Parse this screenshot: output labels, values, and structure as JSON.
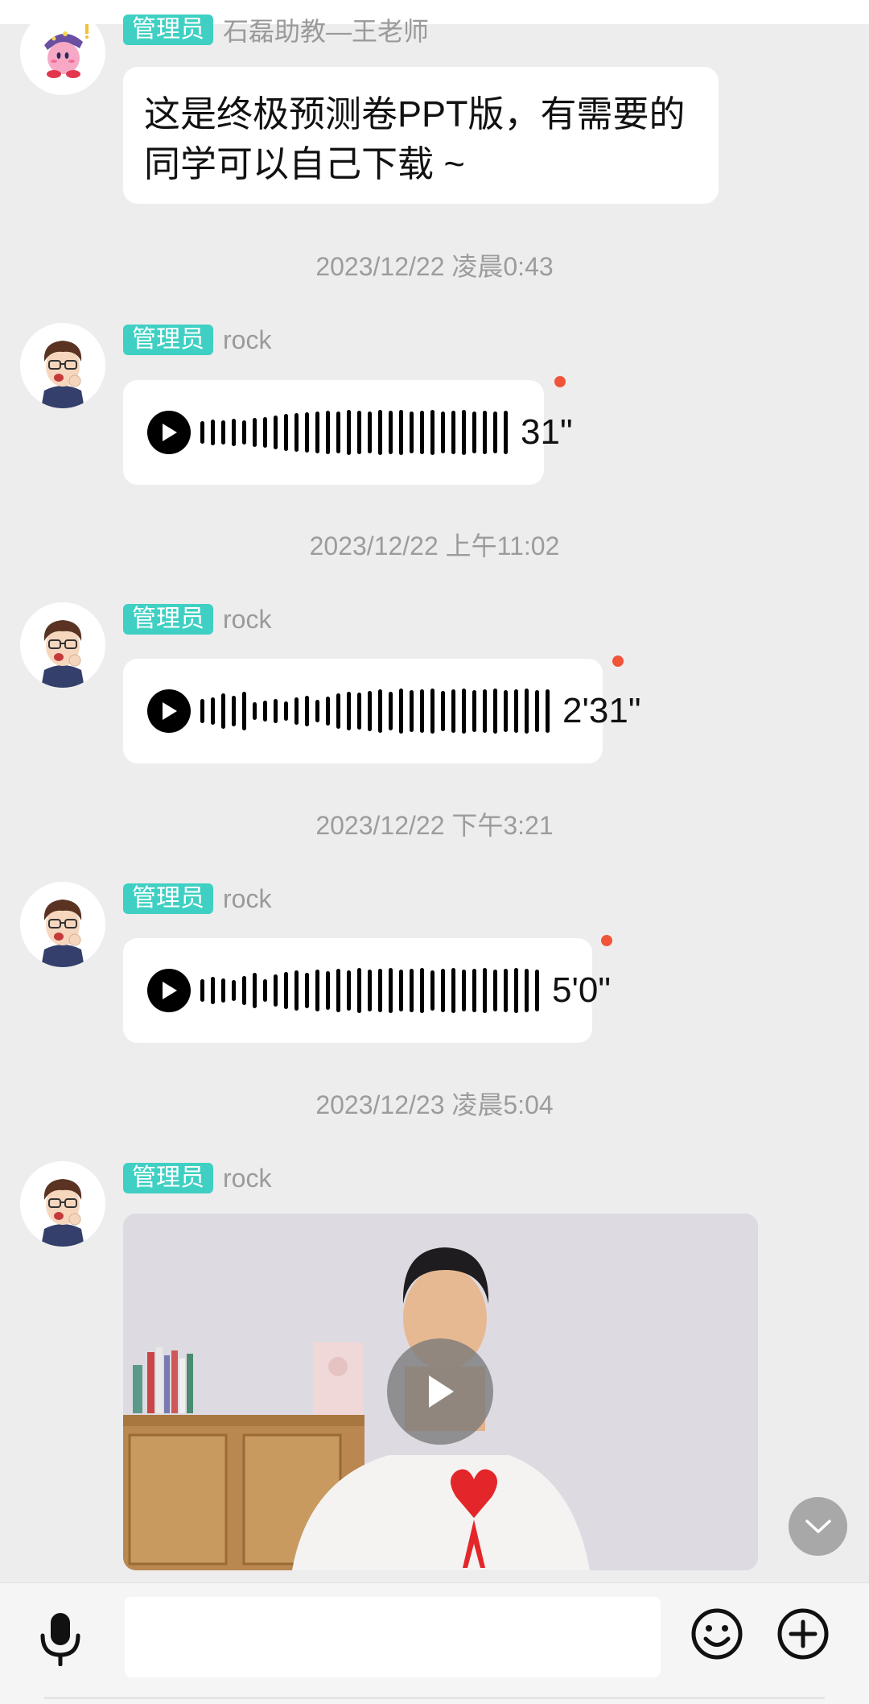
{
  "messages": [
    {
      "badge": "管理员",
      "sender": "石磊助教—王老师",
      "text": "这是终极预测卷PPT版，有需要的同学可以自己下载 ~",
      "avatar_icon": "kirby-avatar-icon"
    },
    {
      "timestamp": "2023/12/22 凌晨0:43",
      "badge": "管理员",
      "sender": "rock",
      "voice_duration": "31\"",
      "unread": true,
      "avatar_icon": "cartoon-man-avatar-icon"
    },
    {
      "timestamp": "2023/12/22 上午11:02",
      "badge": "管理员",
      "sender": "rock",
      "voice_duration": "2'31\"",
      "unread": true,
      "avatar_icon": "cartoon-man-avatar-icon"
    },
    {
      "timestamp": "2023/12/22 下午3:21",
      "badge": "管理员",
      "sender": "rock",
      "voice_duration": "5'0\"",
      "unread": true,
      "avatar_icon": "cartoon-man-avatar-icon"
    },
    {
      "timestamp": "2023/12/23 凌晨5:04",
      "badge": "管理员",
      "sender": "rock",
      "type": "video",
      "avatar_icon": "cartoon-man-avatar-icon"
    }
  ],
  "input": {
    "value": "",
    "placeholder": ""
  },
  "icons": {
    "voice": "microphone-icon",
    "emoji": "smiley-icon",
    "more": "plus-circle-icon",
    "scroll": "chevron-down-icon"
  },
  "colors": {
    "admin_badge": "#3fd0c3",
    "unread_dot": "#f0553a",
    "background": "#ededed",
    "bubble": "#ffffff"
  }
}
